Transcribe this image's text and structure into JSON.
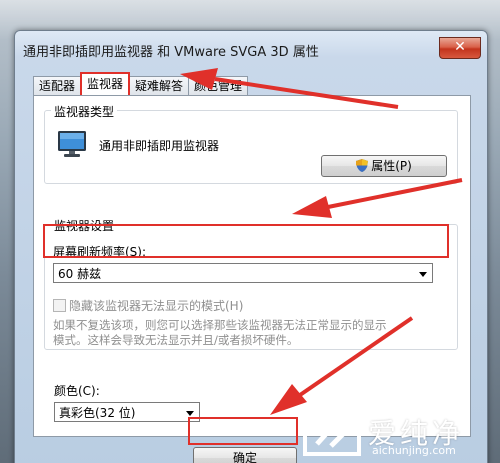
{
  "window": {
    "title": "通用非即插即用监视器 和 VMware SVGA 3D 属性",
    "close_glyph": "✕"
  },
  "tabs": [
    {
      "label": "适配器"
    },
    {
      "label": "监视器"
    },
    {
      "label": "疑难解答"
    },
    {
      "label": "颜色管理"
    }
  ],
  "monitor_type": {
    "group_label": "监视器类型",
    "monitor_name": "通用非即插即用监视器",
    "properties_button": "属性(P)"
  },
  "monitor_settings": {
    "group_label": "监视器设置",
    "refresh_label": "屏幕刷新频率(S):",
    "refresh_value": "60 赫兹",
    "hide_modes_label": "隐藏该监视器无法显示的模式(H)",
    "hide_modes_checked": false,
    "warning_line1": "如果不复选该项，则您可以选择那些该监视器无法正常显示的显示",
    "warning_line2": "模式。这样会导致无法显示并且/或者损坏硬件。"
  },
  "colors": {
    "label": "颜色(C):",
    "value": "真彩色(32 位)"
  },
  "footer": {
    "ok_button": "确定"
  },
  "watermark": {
    "title": "爱纯净",
    "url": "aichunjing.com"
  },
  "accent": {
    "annotation_red": "#e0302a",
    "close_red": "#c3341d"
  },
  "icons": {
    "monitor": "monitor-icon",
    "shield": "uac-shield-icon",
    "dropdown": "chevron-down-icon",
    "close": "close-icon"
  }
}
